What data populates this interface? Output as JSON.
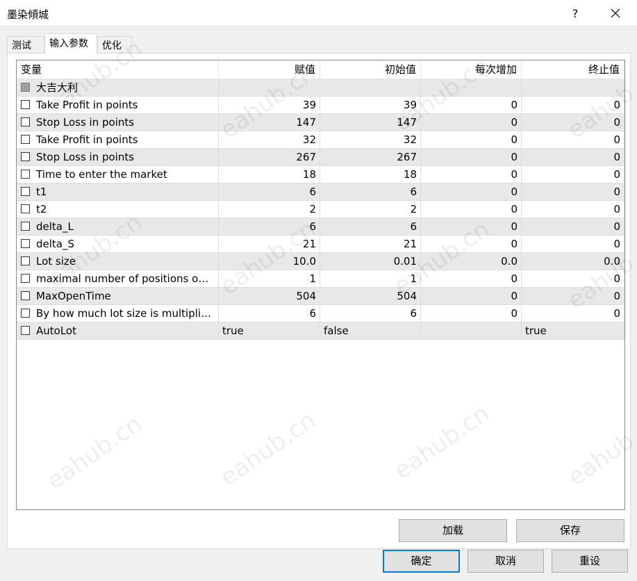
{
  "window": {
    "title": "墨染傾城",
    "help_label": "?"
  },
  "tabs": [
    {
      "label": "测试"
    },
    {
      "label": "输入参数"
    },
    {
      "label": "优化"
    }
  ],
  "grid": {
    "columns": [
      "变量",
      "赋值",
      "初始值",
      "每次增加",
      "终止值"
    ],
    "rows": [
      {
        "name": "大吉大利",
        "value": "",
        "start": "",
        "step": "",
        "stop": "",
        "checkbox_disabled": true
      },
      {
        "name": "Take Profit in points",
        "value": "39",
        "start": "39",
        "step": "0",
        "stop": "0"
      },
      {
        "name": "Stop Loss in points",
        "value": "147",
        "start": "147",
        "step": "0",
        "stop": "0"
      },
      {
        "name": "Take Profit in points",
        "value": "32",
        "start": "32",
        "step": "0",
        "stop": "0"
      },
      {
        "name": "Stop Loss in points",
        "value": "267",
        "start": "267",
        "step": "0",
        "stop": "0"
      },
      {
        "name": "Time to enter the market",
        "value": "18",
        "start": "18",
        "step": "0",
        "stop": "0"
      },
      {
        "name": "t1",
        "value": "6",
        "start": "6",
        "step": "0",
        "stop": "0"
      },
      {
        "name": "t2",
        "value": "2",
        "start": "2",
        "step": "0",
        "stop": "0"
      },
      {
        "name": "delta_L",
        "value": "6",
        "start": "6",
        "step": "0",
        "stop": "0"
      },
      {
        "name": "delta_S",
        "value": "21",
        "start": "21",
        "step": "0",
        "stop": "0"
      },
      {
        "name": "Lot size",
        "value": "10.0",
        "start": "0.01",
        "step": "0.0",
        "stop": "0.0"
      },
      {
        "name": "maximal number of positions ope...",
        "value": "1",
        "start": "1",
        "step": "0",
        "stop": "0"
      },
      {
        "name": "MaxOpenTime",
        "value": "504",
        "start": "504",
        "step": "0",
        "stop": "0"
      },
      {
        "name": "By how much lot size is multiplica...",
        "value": "6",
        "start": "6",
        "step": "0",
        "stop": "0"
      },
      {
        "name": "AutoLot",
        "value": "true",
        "start": "false",
        "step": "",
        "stop": "true",
        "text_left": true
      }
    ]
  },
  "buttons": {
    "load": "加载",
    "save": "保存",
    "ok": "确定",
    "cancel": "取消",
    "reset": "重设"
  },
  "watermark_text": "eahub.cn",
  "colors": {
    "accent": "#0078d7",
    "row_shade": "#e8e8e8"
  }
}
